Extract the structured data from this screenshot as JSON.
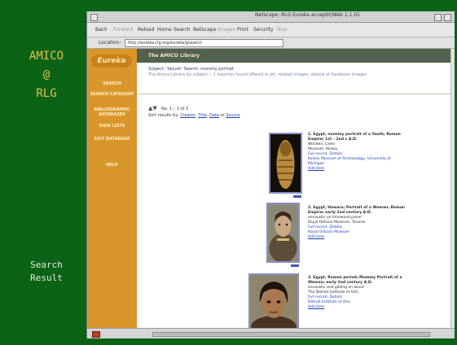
{
  "slide": {
    "title_lines": [
      "AMICO",
      "@",
      "RLG"
    ],
    "caption_lines": [
      "Search",
      "Result"
    ]
  },
  "browser": {
    "window_title": "Netscape: RLG Eureka acceptit/Web 1.1.01",
    "toolbar": [
      "Back",
      "Forward",
      "Reload",
      "Home",
      "Search",
      "Netscape",
      "Images",
      "Print",
      "Security",
      "Stop"
    ],
    "location_label": "Location:",
    "location_url": "http://eureka.rlg.org/eureka/gsearch"
  },
  "site": {
    "logo": "Eureka",
    "header": "The AMICO Library",
    "nav": [
      "SEARCH",
      "SEARCH CATEGORY",
      "BIBLIOGRAPHIC DATABASES",
      "VIEW LISTS",
      "EXIT DATABASE",
      "HELP"
    ],
    "intro_1": "Subject: 'faiyum' Search: mummy portrait",
    "intro_2": "The Amico Library by subject -- 1 matches found offered in art, related images, details of hardware images",
    "nav_range": "No. 1 – 3 of 3",
    "sort_prefix": "Sort results by:",
    "sort_options": [
      "Creator",
      "Title",
      "Date",
      "Source"
    ]
  },
  "results": [
    {
      "line1": "1. Egypt, mummy portrait of a Youth; Roman Empire; 1st – 2nd c A.D.",
      "line2": "Wooden, Linen",
      "line3": "Museum, Kelsey",
      "line4": "Full record, Details",
      "line5": "Kelsey Museum of Archaeology, University of Michigan",
      "action": "Add item"
    },
    {
      "line1": "2. Egypt, Hawara; Portrait of a Woman; Roman Empire; early 2nd century A.D.",
      "line2": "encaustic on limewood panel",
      "line3": "Royal Ontario Museum, Toronto",
      "line4": "Full record, Details",
      "line5": "Royal Ontario Museum",
      "action": "Add item"
    },
    {
      "line1": "3. Egypt, Roman period; Mummy Portrait of a Woman; early 2nd century A.D.",
      "line2": "encaustic and gilding on wood",
      "line3": "The Detroit Institute of Arts",
      "line4": "Full record, Details",
      "line5": "Detroit Institute of Arts",
      "action": "Add item"
    }
  ]
}
